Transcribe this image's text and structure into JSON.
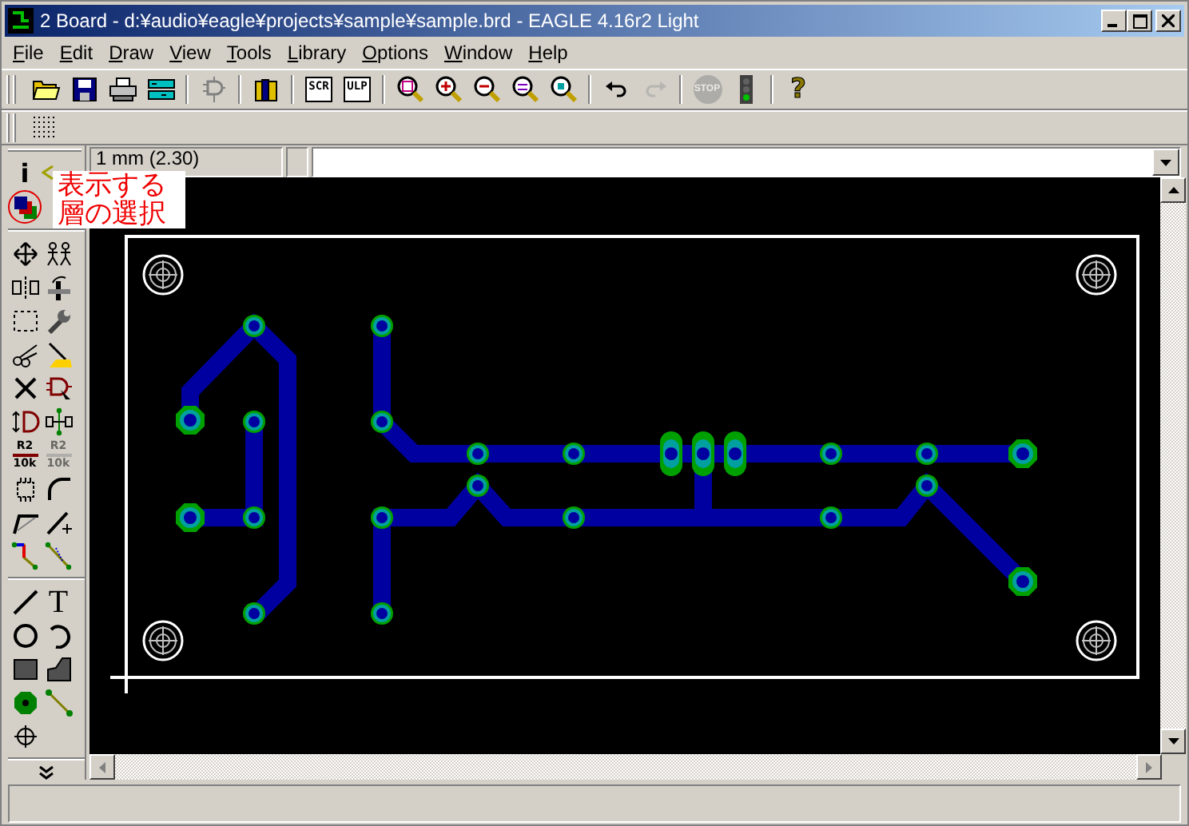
{
  "window": {
    "title": "2 Board - d:¥audio¥eagle¥projects¥sample¥sample.brd - EAGLE 4.16r2 Light"
  },
  "menu": [
    {
      "label": "File"
    },
    {
      "label": "Edit"
    },
    {
      "label": "Draw"
    },
    {
      "label": "View"
    },
    {
      "label": "Tools"
    },
    {
      "label": "Library"
    },
    {
      "label": "Options"
    },
    {
      "label": "Window"
    },
    {
      "label": "Help"
    }
  ],
  "toolbar": [
    {
      "kind": "open",
      "disabled": false
    },
    {
      "kind": "save",
      "disabled": false
    },
    {
      "kind": "print",
      "disabled": false
    },
    {
      "kind": "cam",
      "disabled": false
    },
    {
      "kind": "separator"
    },
    {
      "kind": "switch",
      "disabled": false
    },
    {
      "kind": "separator"
    },
    {
      "kind": "books",
      "disabled": false
    },
    {
      "kind": "separator"
    },
    {
      "kind": "script",
      "label": "SCR",
      "disabled": false
    },
    {
      "kind": "script",
      "label": "ULP",
      "disabled": false
    },
    {
      "kind": "separator"
    },
    {
      "kind": "zoom-fit",
      "disabled": false
    },
    {
      "kind": "zoom-in",
      "disabled": false
    },
    {
      "kind": "zoom-out",
      "disabled": false
    },
    {
      "kind": "zoom-redraw",
      "disabled": false
    },
    {
      "kind": "zoom-select",
      "disabled": false
    },
    {
      "kind": "separator"
    },
    {
      "kind": "undo",
      "disabled": false
    },
    {
      "kind": "redo",
      "disabled": true
    },
    {
      "kind": "separator"
    },
    {
      "kind": "stop",
      "label": "STOP",
      "disabled": true
    },
    {
      "kind": "go",
      "disabled": false
    },
    {
      "kind": "separator"
    },
    {
      "kind": "help",
      "label": "?",
      "disabled": false
    }
  ],
  "coordinate_readout": "1 mm (2.30)",
  "palette_top": [
    {
      "kind": "info",
      "label": "i",
      "disabled": false
    },
    {
      "kind": "layers",
      "disabled": false
    }
  ],
  "palette": [
    {
      "kind": "move",
      "disabled": false
    },
    {
      "kind": "group",
      "disabled": false
    },
    {
      "kind": "mirror",
      "disabled": false
    },
    {
      "kind": "rotate",
      "disabled": false
    },
    {
      "kind": "select",
      "disabled": false
    },
    {
      "kind": "change",
      "disabled": false
    },
    {
      "kind": "cut",
      "disabled": false
    },
    {
      "kind": "paste",
      "disabled": false
    },
    {
      "kind": "delete",
      "disabled": false
    },
    {
      "kind": "add",
      "disabled": false
    },
    {
      "kind": "pinswap",
      "disabled": false
    },
    {
      "kind": "replace",
      "disabled": false
    },
    {
      "kind": "value",
      "label": "R2",
      "sublabel": "10k",
      "disabled": false
    },
    {
      "kind": "value",
      "label": "R2",
      "sublabel": "10k",
      "disabled": true
    },
    {
      "kind": "smash",
      "disabled": false
    },
    {
      "kind": "miter",
      "disabled": false
    },
    {
      "kind": "split",
      "disabled": false
    },
    {
      "kind": "optimize",
      "disabled": false
    },
    {
      "kind": "route",
      "disabled": false
    },
    {
      "kind": "ripup",
      "disabled": false
    }
  ],
  "palette_draw": [
    {
      "kind": "wire",
      "disabled": false
    },
    {
      "kind": "text",
      "label": "T",
      "disabled": false
    },
    {
      "kind": "circle",
      "disabled": false
    },
    {
      "kind": "arc",
      "disabled": false
    },
    {
      "kind": "rect",
      "disabled": false
    },
    {
      "kind": "polygon",
      "disabled": false
    },
    {
      "kind": "via",
      "disabled": false
    },
    {
      "kind": "signal",
      "disabled": false
    },
    {
      "kind": "hole",
      "disabled": false
    }
  ],
  "callout": {
    "lines": [
      "表示する",
      "層の選択"
    ]
  }
}
